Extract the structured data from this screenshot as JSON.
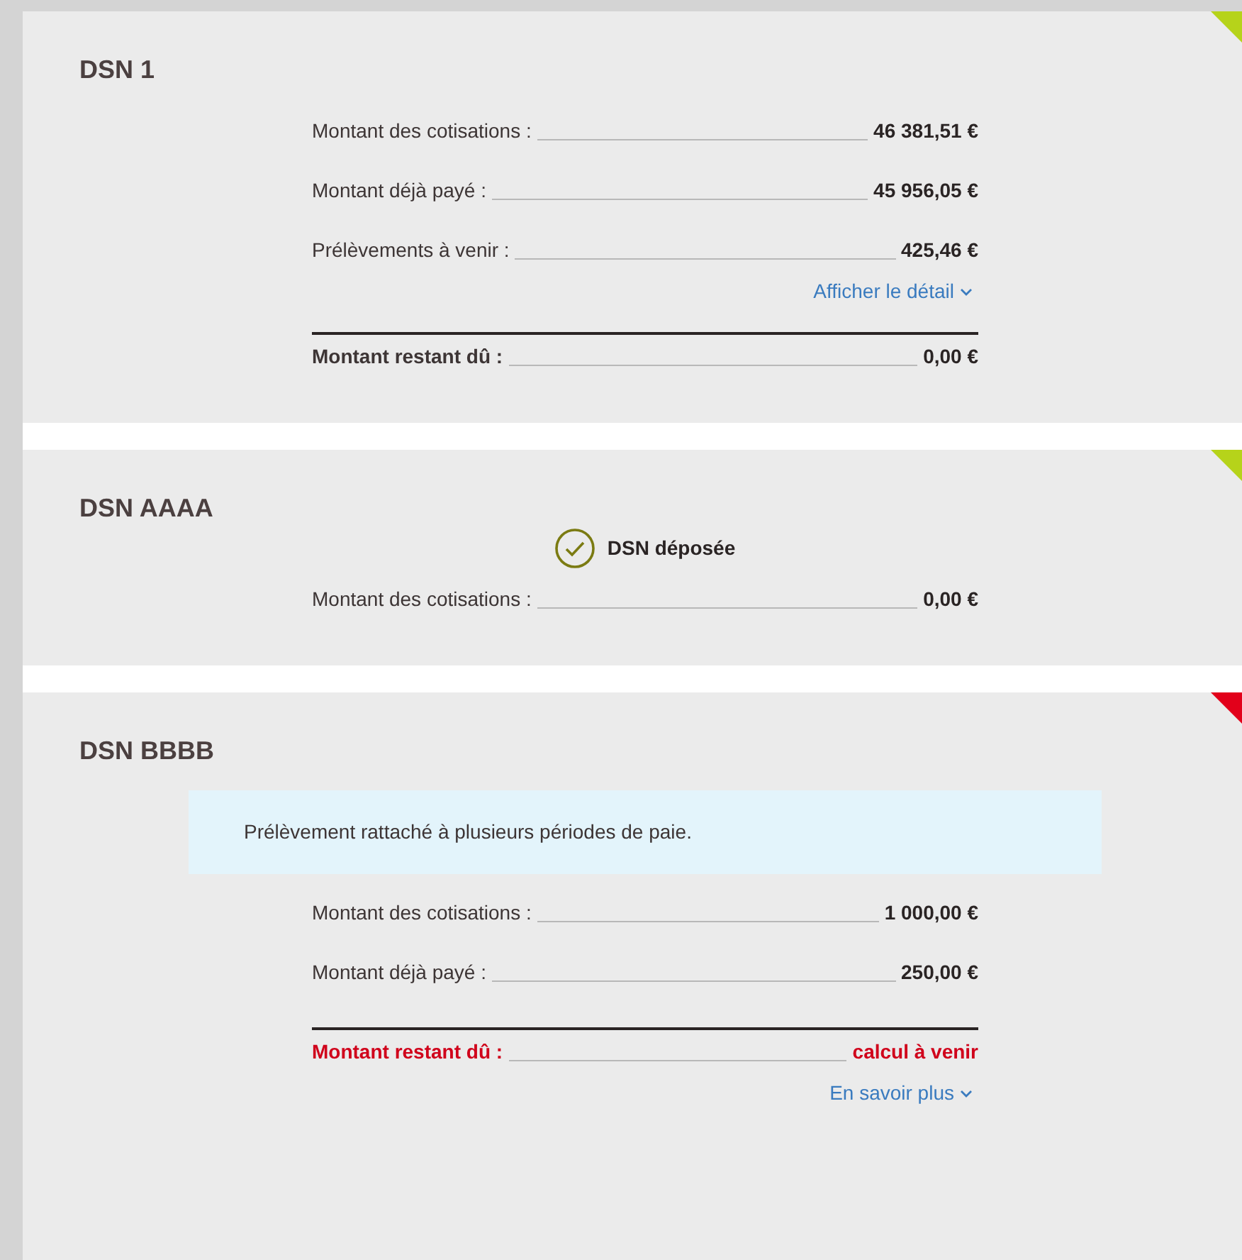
{
  "cards": [
    {
      "title": "DSN 1",
      "color": "#b6d31a",
      "items": [
        {
          "kind": "amount",
          "label": "Montant des cotisations :",
          "value": "46 381,51 €",
          "alert": false
        },
        {
          "kind": "amount",
          "label": "Montant déjà payé :",
          "value": "45 956,05 €",
          "alert": false
        },
        {
          "kind": "amount",
          "label": "Prélèvements à venir :",
          "value": "425,46 €",
          "alert": false
        },
        {
          "kind": "link",
          "label": "Afficher le détail"
        },
        {
          "kind": "total",
          "label": "Montant restant dû :",
          "value": "0,00 €",
          "alert": false
        }
      ]
    },
    {
      "title": "DSN AAAA",
      "color": "#b6d31a",
      "items": [
        {
          "kind": "status",
          "label": "DSN déposée"
        },
        {
          "kind": "amount",
          "label": "Montant des cotisations :",
          "value": "0,00 €",
          "alert": false
        }
      ]
    },
    {
      "title": "DSN BBBB",
      "color": "#e2001a",
      "items": [
        {
          "kind": "notice",
          "label": "Prélèvement rattaché à plusieurs périodes de paie."
        },
        {
          "kind": "amount",
          "label": "Montant des cotisations :",
          "value": "1 000,00 €",
          "alert": false
        },
        {
          "kind": "amount",
          "label": "Montant déjà payé :",
          "value": "250,00 €",
          "alert": false
        },
        {
          "kind": "total",
          "label": "Montant restant dû :",
          "value": "calcul à venir",
          "alert": true
        },
        {
          "kind": "link",
          "label": "En savoir plus"
        }
      ]
    }
  ]
}
